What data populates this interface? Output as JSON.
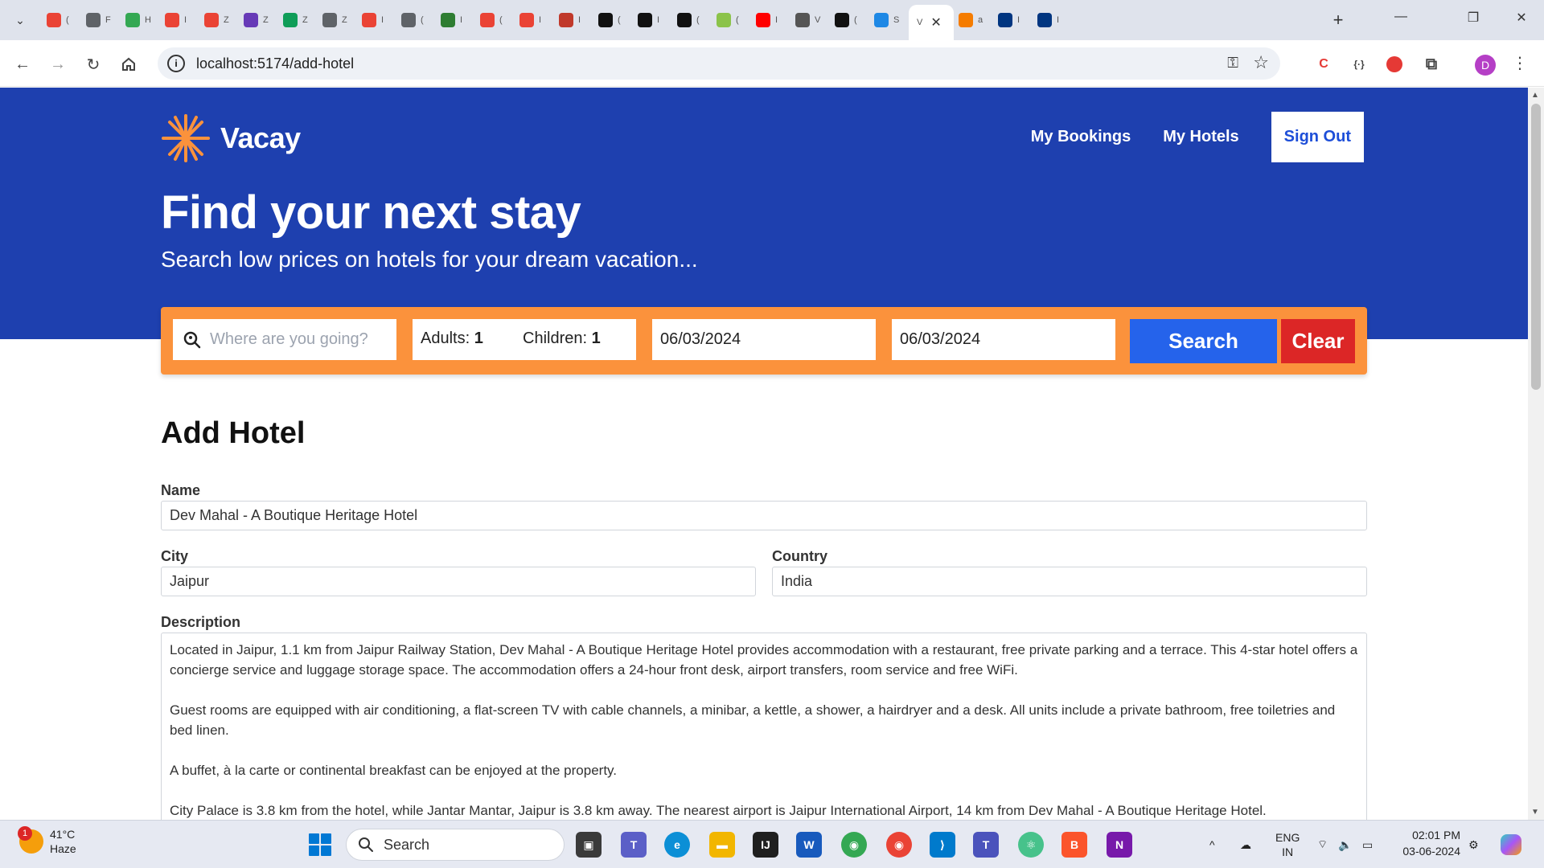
{
  "browser": {
    "tabs": [
      {
        "icon": "gmail-icon",
        "label": "(",
        "color": "#ea4335"
      },
      {
        "icon": "globe-icon",
        "label": "F",
        "color": "#5f6368"
      },
      {
        "icon": "drive-icon",
        "label": "H",
        "color": "#34a853"
      },
      {
        "icon": "gmail-icon",
        "label": "I",
        "color": "#ea4335"
      },
      {
        "icon": "gmail-icon",
        "label": "Z",
        "color": "#ea4335"
      },
      {
        "icon": "forms-icon",
        "label": "Z",
        "color": "#673ab7"
      },
      {
        "icon": "sheets-icon",
        "label": "Z",
        "color": "#0f9d58"
      },
      {
        "icon": "globe-icon",
        "label": "Z",
        "color": "#5f6368"
      },
      {
        "icon": "gmail-icon",
        "label": "I",
        "color": "#ea4335"
      },
      {
        "icon": "globe-icon",
        "label": "(",
        "color": "#5f6368"
      },
      {
        "icon": "doc-icon",
        "label": "I",
        "color": "#2e7d32"
      },
      {
        "icon": "gmail-icon",
        "label": "(",
        "color": "#ea4335"
      },
      {
        "icon": "gmail-icon",
        "label": "I",
        "color": "#ea4335"
      },
      {
        "icon": "mongo-icon",
        "label": "I",
        "color": "#c0392b"
      },
      {
        "icon": "openai-icon",
        "label": "(",
        "color": "#111111"
      },
      {
        "icon": "triangle-icon",
        "label": "I",
        "color": "#111111"
      },
      {
        "icon": "circle-icon",
        "label": "(",
        "color": "#111111"
      },
      {
        "icon": "leaf-icon",
        "label": "(",
        "color": "#8bc34a"
      },
      {
        "icon": "youtube-icon",
        "label": "I",
        "color": "#ff0000"
      },
      {
        "icon": "edit-icon",
        "label": "V",
        "color": "#555555"
      },
      {
        "icon": "github-icon",
        "label": "(",
        "color": "#111111"
      },
      {
        "icon": "s-icon",
        "label": "S",
        "color": "#1e88e5"
      }
    ],
    "active_tab": {
      "label": "V",
      "close": "✕"
    },
    "tabs_after": [
      {
        "icon": "fire-icon",
        "label": "a",
        "color": "#f57c00"
      },
      {
        "icon": "booking-icon",
        "label": "I",
        "color": "#003580"
      },
      {
        "icon": "booking-icon",
        "label": "I",
        "color": "#003580"
      }
    ],
    "url": "localhost:5174/add-hotel",
    "profile_initial": "D"
  },
  "site": {
    "brand": "Vacay",
    "nav": {
      "my_bookings": "My Bookings",
      "my_hotels": "My Hotels",
      "sign_out": "Sign Out"
    },
    "hero_title": "Find your next stay",
    "hero_subtitle": "Search low prices on hotels for your dream vacation...",
    "colors": {
      "hero_bg": "#1e40af",
      "search_bar": "#fb923c",
      "search_button": "#2563eb",
      "clear_button": "#dc2626",
      "logo_star": "#fb923c"
    }
  },
  "search": {
    "destination_placeholder": "Where are you going?",
    "adults_label": "Adults:",
    "adults_value": "1",
    "children_label": "Children:",
    "children_value": "1",
    "check_in": "06/03/2024",
    "check_out": "06/03/2024",
    "search_label": "Search",
    "clear_label": "Clear"
  },
  "form": {
    "title": "Add Hotel",
    "name_label": "Name",
    "name_value": "Dev Mahal - A Boutique Heritage Hotel",
    "city_label": "City",
    "city_value": "Jaipur",
    "country_label": "Country",
    "country_value": "India",
    "description_label": "Description",
    "description_paragraphs": [
      "Located in Jaipur, 1.1 km from Jaipur Railway Station, Dev Mahal - A Boutique Heritage Hotel provides accommodation with a restaurant, free private parking and a terrace. This 4-star hotel offers a concierge service and luggage storage space. The accommodation offers a 24-hour front desk, airport transfers, room service and free WiFi.",
      "Guest rooms are equipped with air conditioning, a flat-screen TV with cable channels, a minibar, a kettle, a shower, a hairdryer and a desk. All units include a private bathroom, free toiletries and bed linen.",
      "A buffet, à la carte or continental breakfast can be enjoyed at the property.",
      "City Palace is 3.8 km from the hotel, while Jantar Mantar, Jaipur is 3.8 km away. The nearest airport is Jaipur International Airport, 14 km from Dev Mahal - A Boutique Heritage Hotel."
    ]
  },
  "taskbar": {
    "weather_temp": "41°C",
    "weather_desc": "Haze",
    "weather_badge": "1",
    "search_label": "Search",
    "language": "ENG",
    "region": "IN",
    "time": "02:01 PM",
    "date": "03-06-2024"
  }
}
